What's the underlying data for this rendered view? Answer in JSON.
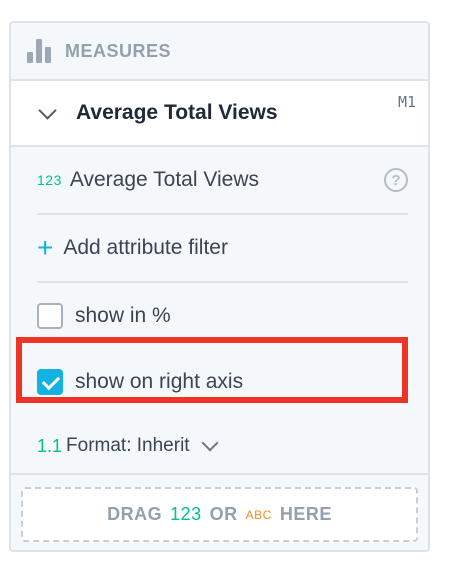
{
  "header": {
    "label": "MEASURES",
    "icon": "bar-chart-icon"
  },
  "measure": {
    "title": "Average Total Views",
    "badge": "M1",
    "metric": {
      "type_badge": "123",
      "name": "Average Total Views",
      "help_icon": "question-icon"
    },
    "add_filter": {
      "icon": "plus-icon",
      "label": "Add attribute filter"
    },
    "options": [
      {
        "label": "show in %",
        "checked": false
      },
      {
        "label": "show on right axis",
        "checked": true
      }
    ],
    "format": {
      "prefix": "1.1",
      "label": "Format: Inherit"
    }
  },
  "dropzone": {
    "drag": "DRAG",
    "num": "123",
    "or": "OR",
    "abc": "ABC",
    "here": "HERE"
  },
  "colors": {
    "accent": "#14b2e2",
    "numeric": "#00c18d",
    "attribute": "#f08e23",
    "highlight": "#ec3526"
  }
}
